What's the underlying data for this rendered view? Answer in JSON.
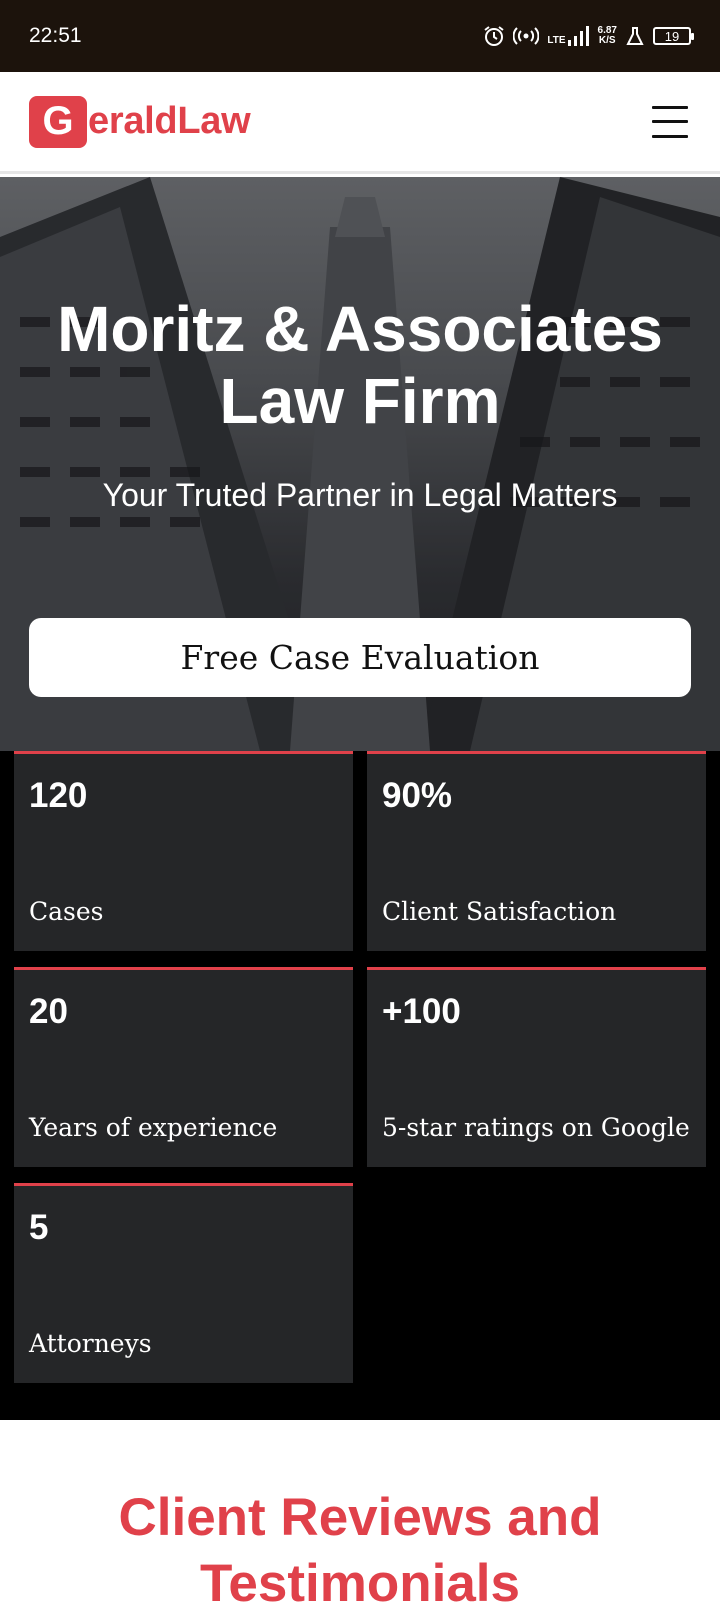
{
  "status_bar": {
    "time": "22:51",
    "network": "LTE",
    "speed_value": "6.87",
    "speed_unit": "K/S",
    "battery": "19",
    "icons": [
      "alarm-icon",
      "hotspot-icon",
      "signal-icon",
      "flask-icon",
      "battery-icon"
    ]
  },
  "header": {
    "logo_letter": "G",
    "logo_text": "eraldLaw",
    "menu_icon": "hamburger-menu-icon"
  },
  "hero": {
    "title_line1": "Moritz & Associates",
    "title_line2": "Law Firm",
    "subtitle": "Your Truted Partner in Legal Matters",
    "cta_label": "Free Case Evaluation"
  },
  "stats": [
    {
      "value": "120",
      "label": "Cases"
    },
    {
      "value": "90%",
      "label": "Client Satisfaction"
    },
    {
      "value": "20",
      "label": "Years of experience"
    },
    {
      "value": "+100",
      "label": "5-star ratings on Google"
    },
    {
      "value": "5",
      "label": "Attorneys"
    }
  ],
  "reviews": {
    "title_line1": "Client Reviews and",
    "title_line2": "Testimonials"
  },
  "colors": {
    "accent": "#e0414a",
    "status_bar": "#1c130c",
    "card": "#252628"
  }
}
